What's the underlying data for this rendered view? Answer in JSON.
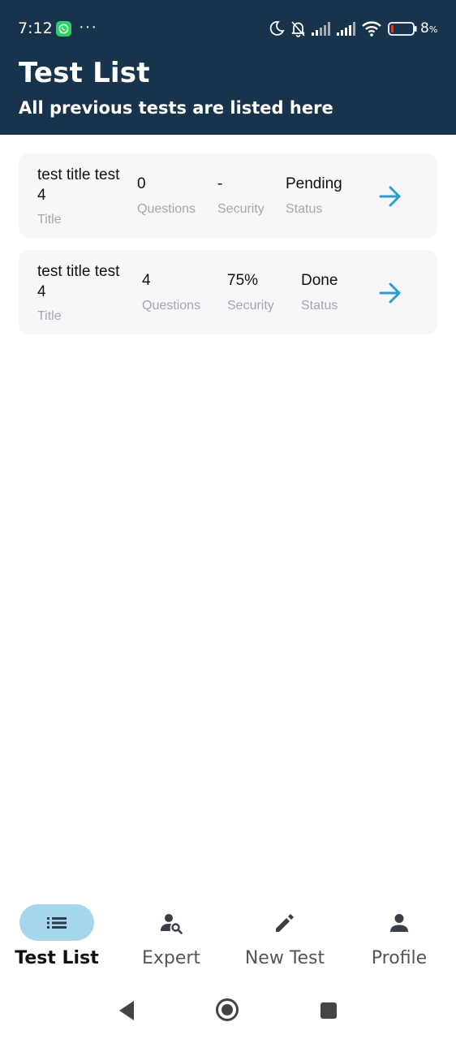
{
  "status_bar": {
    "time": "7:12",
    "more": "···",
    "battery_percent": "8",
    "battery_unit": "%"
  },
  "header": {
    "title": "Test List",
    "subtitle": "All previous tests are listed here",
    "background_color": "#17344c"
  },
  "tests": [
    {
      "title": "test title test 4",
      "title_label": "Title",
      "questions": "0",
      "questions_label": "Questions",
      "security": "-",
      "security_label": "Security",
      "status": "Pending",
      "status_label": "Status",
      "action_icon": "arrow-right-icon"
    },
    {
      "title": "test title test 4",
      "title_label": "Title",
      "questions": "4",
      "questions_label": "Questions",
      "security": "75%",
      "security_label": "Security",
      "status": "Done",
      "status_label": "Status",
      "action_icon": "arrow-right-icon"
    }
  ],
  "bottom_nav": {
    "active_index": 0,
    "active_color": "#a6d6ec",
    "items": [
      {
        "label": "Test List",
        "icon": "list-icon"
      },
      {
        "label": "Expert",
        "icon": "person-search-icon"
      },
      {
        "label": "New Test",
        "icon": "pencil-icon"
      },
      {
        "label": "Profile",
        "icon": "person-icon"
      }
    ]
  },
  "accent_color": "#2e9ccc"
}
